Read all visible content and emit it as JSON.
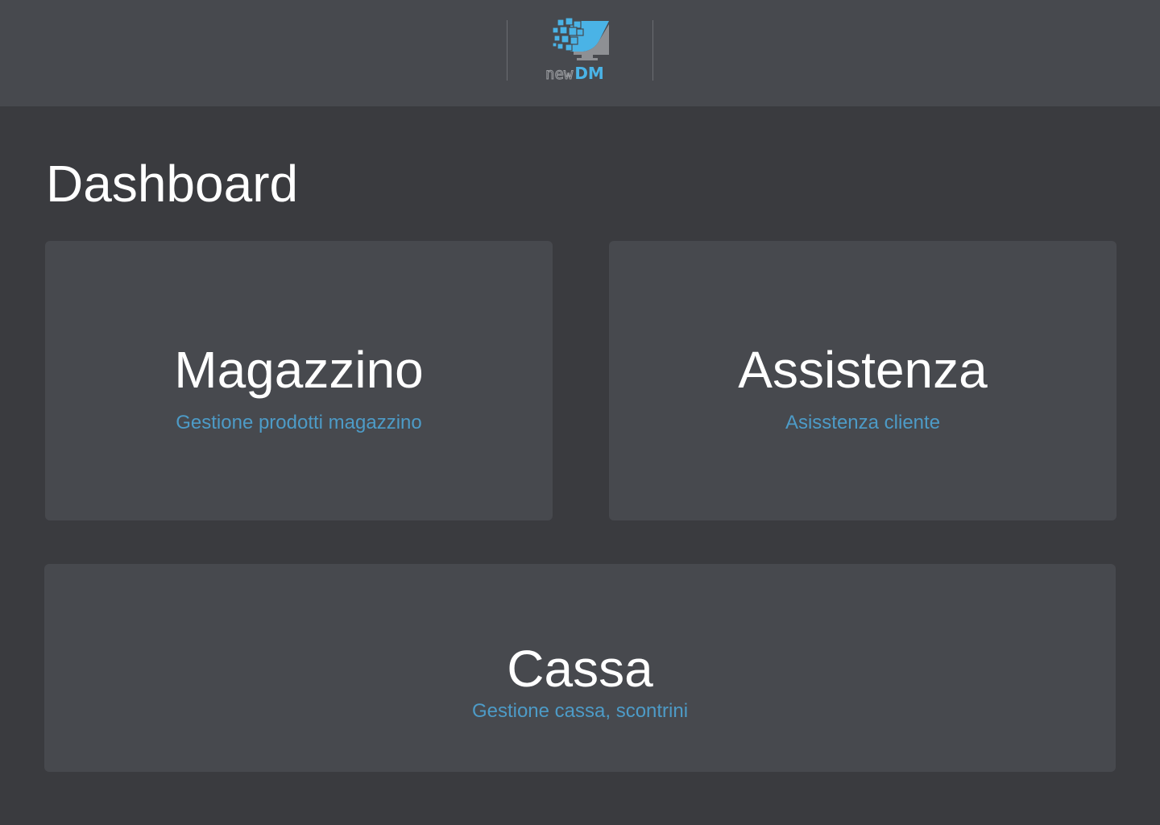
{
  "header": {
    "logo": {
      "text_new": "new",
      "text_dm": "DM",
      "icon": "monitor-pixels-logo-icon",
      "colors": {
        "accent": "#4ab3e6",
        "gray": "#9a9ca0"
      }
    }
  },
  "page": {
    "title": "Dashboard"
  },
  "cards": [
    {
      "title": "Magazzino",
      "subtitle": "Gestione prodotti magazzino"
    },
    {
      "title": "Assistenza",
      "subtitle": "Asisstenza cliente"
    },
    {
      "title": "Cassa",
      "subtitle": "Gestione cassa, scontrini"
    }
  ],
  "colors": {
    "background": "#3a3b3f",
    "header_bg": "#47494e",
    "card_bg": "#47494e",
    "title_text": "#ffffff",
    "subtitle_text": "#4d9bc7"
  }
}
